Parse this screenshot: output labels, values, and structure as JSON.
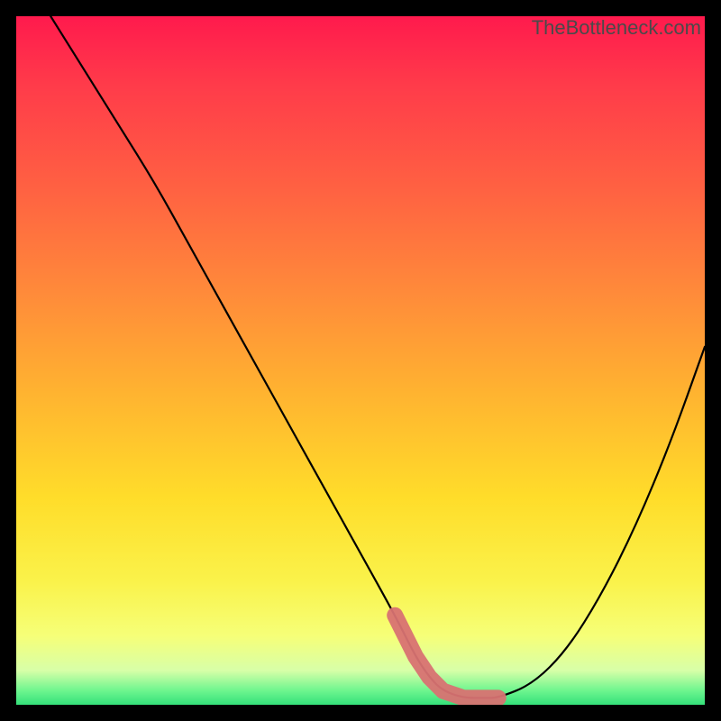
{
  "watermark": "TheBottleneck.com",
  "chart_data": {
    "type": "line",
    "title": "",
    "xlabel": "",
    "ylabel": "",
    "xlim": [
      0,
      100
    ],
    "ylim": [
      0,
      100
    ],
    "series": [
      {
        "name": "curve",
        "x": [
          5,
          10,
          15,
          20,
          25,
          30,
          35,
          40,
          45,
          50,
          55,
          58,
          60,
          62,
          65,
          68,
          70,
          75,
          80,
          85,
          90,
          95,
          100
        ],
        "y": [
          100,
          92,
          84,
          76,
          67,
          58,
          49,
          40,
          31,
          22,
          13,
          7,
          4,
          2,
          1,
          1,
          1,
          3,
          8,
          16,
          26,
          38,
          52
        ]
      }
    ],
    "highlight_band": {
      "color": "#d87272",
      "points_x": [
        55,
        58,
        60,
        62,
        65,
        68,
        70
      ],
      "points_y": [
        13,
        7,
        4,
        2,
        1,
        1,
        1
      ]
    },
    "background_gradient": {
      "top": "#ff1a4d",
      "upper_mid": "#ff8a3a",
      "mid": "#ffdd2a",
      "lower_mid": "#f6ff78",
      "bottom": "#34e07a"
    }
  }
}
